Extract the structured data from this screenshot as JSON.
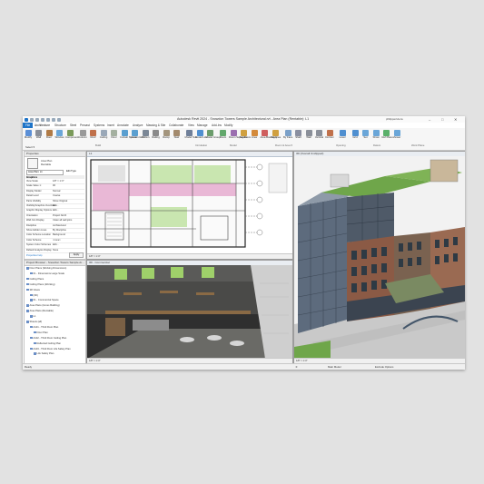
{
  "app": {
    "title": "Autodesk Revit 2024 - Snowdon Towers Sample Architectural.rvt - Area Plan (Rentable): L1",
    "user": "philipperiviera",
    "window_controls": [
      "–",
      "□",
      "✕"
    ]
  },
  "ribbon": {
    "tabs": [
      "File",
      "Architecture",
      "Structure",
      "Steel",
      "Precast",
      "Systems",
      "Insert",
      "Annotate",
      "Analyze",
      "Massing & Site",
      "Collaborate",
      "View",
      "Manage",
      "Add-Ins",
      "Modify"
    ],
    "active_tab": "Architecture",
    "buttons": [
      {
        "label": "Modify",
        "icon": "cursor-icon",
        "color": "#5b8fd6"
      },
      {
        "label": "Wall",
        "icon": "wall-icon",
        "color": "#8a8f99"
      },
      {
        "label": "Door",
        "icon": "door-icon",
        "color": "#b07a45"
      },
      {
        "label": "Window",
        "icon": "window-icon",
        "color": "#6aa6d8"
      },
      {
        "label": "Component",
        "icon": "component-icon",
        "color": "#7a9a5a"
      },
      {
        "label": "Column",
        "icon": "column-icon",
        "color": "#999999"
      },
      {
        "label": "Roof",
        "icon": "roof-icon",
        "color": "#c0704a"
      },
      {
        "label": "Ceiling",
        "icon": "ceiling-icon",
        "color": "#9aa8b8"
      },
      {
        "label": "Floor",
        "icon": "floor-icon",
        "color": "#a4b0a0"
      },
      {
        "label": "Curtain System",
        "icon": "curtain-system-icon",
        "color": "#5a9fd0"
      },
      {
        "label": "Curtain Grid",
        "icon": "curtain-grid-icon",
        "color": "#5a9fd0"
      },
      {
        "label": "Mullion",
        "icon": "mullion-icon",
        "color": "#7b8796"
      },
      {
        "label": "Railing",
        "icon": "railing-icon",
        "color": "#8a8a8a"
      },
      {
        "label": "Ramp",
        "icon": "ramp-icon",
        "color": "#a3957d"
      },
      {
        "label": "Stair",
        "icon": "stair-icon",
        "color": "#a38a6d"
      },
      {
        "label": "Model Text",
        "icon": "model-text-icon",
        "color": "#6f7f99"
      },
      {
        "label": "Model Line",
        "icon": "model-line-icon",
        "color": "#4f8fd0"
      },
      {
        "label": "Model Group",
        "icon": "model-group-icon",
        "color": "#6b9c6b"
      },
      {
        "label": "Room",
        "icon": "room-icon",
        "color": "#62a86c"
      },
      {
        "label": "Room Separator",
        "icon": "room-separator-icon",
        "color": "#9b6fb0"
      },
      {
        "label": "Tag Room",
        "icon": "tag-room-icon",
        "color": "#d0a040"
      },
      {
        "label": "Area",
        "icon": "area-icon",
        "color": "#d48a3a"
      },
      {
        "label": "Area Boundary",
        "icon": "area-boundary-icon",
        "color": "#cf5f5f"
      },
      {
        "label": "Tag Area",
        "icon": "tag-area-icon",
        "color": "#d0a040"
      },
      {
        "label": "By Face",
        "icon": "by-face-icon",
        "color": "#7aa0c8"
      },
      {
        "label": "Shaft",
        "icon": "shaft-icon",
        "color": "#8a8fa0"
      },
      {
        "label": "Wall",
        "icon": "opening-wall-icon",
        "color": "#8a8f99"
      },
      {
        "label": "Vertical",
        "icon": "vertical-icon",
        "color": "#8a8f99"
      },
      {
        "label": "Dormer",
        "icon": "dormer-icon",
        "color": "#c0704a"
      },
      {
        "label": "Level",
        "icon": "level-icon",
        "color": "#4f8fd0"
      },
      {
        "label": "Grid",
        "icon": "grid-icon",
        "color": "#4f8fd0"
      },
      {
        "label": "Set",
        "icon": "set-icon",
        "color": "#6aa6d8"
      },
      {
        "label": "Show",
        "icon": "show-icon",
        "color": "#6aa6d8"
      },
      {
        "label": "Ref Plane",
        "icon": "ref-plane-icon",
        "color": "#5ab06a"
      },
      {
        "label": "Viewer",
        "icon": "viewer-icon",
        "color": "#6aa6d8"
      }
    ],
    "groups": [
      "Select ▾",
      "Build",
      "Circulation",
      "Model",
      "Room & Area ▾",
      "Opening",
      "Datum",
      "Work Plane"
    ]
  },
  "properties": {
    "title": "Properties",
    "type_name": "Area Plan",
    "type_sub": "Rentable",
    "selector": "Area Plan: L1",
    "edit_type": "Edit Type",
    "section": "Graphics",
    "rows": [
      {
        "k": "View Scale",
        "v": "1/8\" = 1'-0\""
      },
      {
        "k": "Scale Value 1:",
        "v": "96"
      },
      {
        "k": "Display Model",
        "v": "Normal"
      },
      {
        "k": "Detail Level",
        "v": "Coarse"
      },
      {
        "k": "Parts Visibility",
        "v": "Show Original"
      },
      {
        "k": "Visibility/Graphics Overrides",
        "v": "Edit..."
      },
      {
        "k": "Graphic Display Options",
        "v": "Edit..."
      },
      {
        "k": "Orientation",
        "v": "Project North"
      },
      {
        "k": "Wall Join Display",
        "v": "Clean all wall joins"
      },
      {
        "k": "Discipline",
        "v": "Architectural"
      },
      {
        "k": "Show Hidden Lines",
        "v": "By Discipline"
      },
      {
        "k": "Color Scheme Location",
        "v": "Background"
      },
      {
        "k": "Color Scheme",
        "v": "<none>"
      },
      {
        "k": "System Color Schemes",
        "v": "Edit..."
      },
      {
        "k": "Default Analysis Display",
        "v": "None"
      }
    ],
    "help": "Properties help",
    "apply": "Apply"
  },
  "browser": {
    "title": "Project Browser - Snowdon Towers Sample Ar...",
    "items": [
      "Floor Plans (Working Dimensions)",
      "01 - Dimensions Large Scale",
      "Ceiling Plans",
      "Ceiling Plans (Working)",
      "3D Views",
      "{3D}",
      "01 - Commercial Space",
      "Area Plans (Gross Building)",
      "Area Plans (Rentable)",
      "L1",
      "Sheets (all)",
      "A101 - Third Floor Plan",
      "Floor Plan",
      "A102 - Third Floor Ceiling Plan",
      "Reflected Ceiling Plan",
      "A103 - Third Floor Life Safety Plan",
      "Life Safety Plan"
    ]
  },
  "views": {
    "plan_title": "L1",
    "axon_title": "3D (Overall Unclipped)",
    "section_title": "3D - Commercial",
    "plan_scale": "1/8\" = 1'-0\"",
    "section_scale": "1/8\" = 1'-0\"",
    "axon_scale": "1/8\" = 1'-0\""
  },
  "status": {
    "left": "Ready",
    "model": "Main Model",
    "exclude": "Exclude Options",
    "zoom": ":0"
  },
  "colors": {
    "accent": "#1e74c8",
    "plan_pink": "#e9b8d6",
    "plan_green": "#c9e6b0",
    "roof_green": "#6fa64a",
    "brick": "#8b5a45",
    "glass": "#5d6b7d"
  }
}
